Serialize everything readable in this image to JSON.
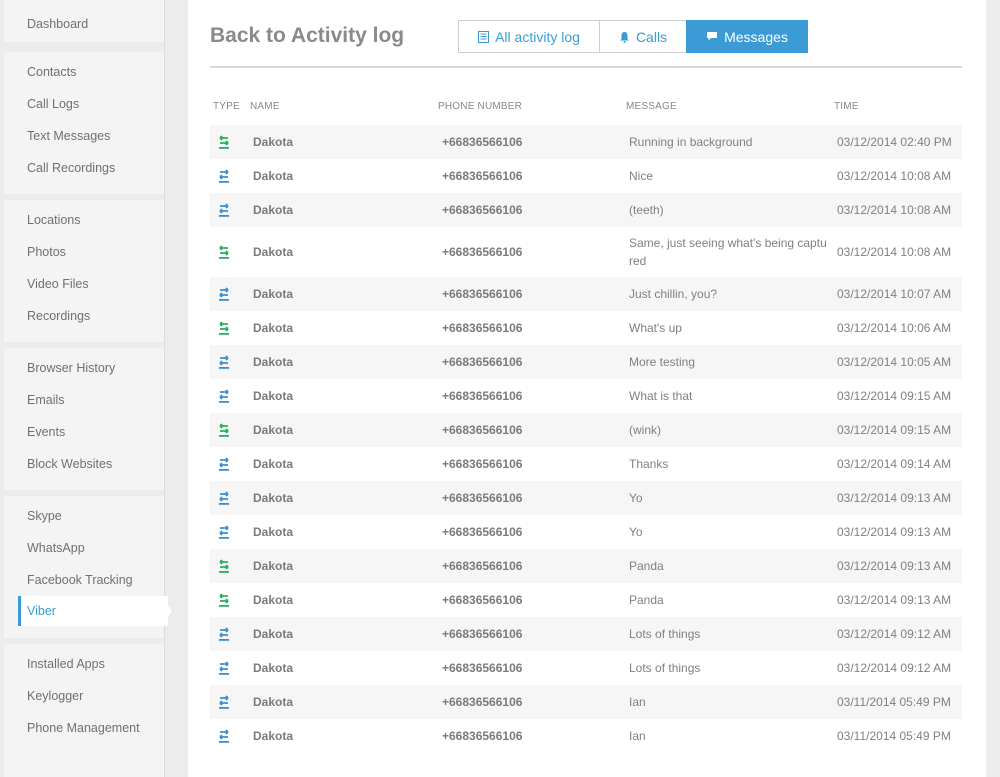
{
  "sidebar": {
    "groups": [
      {
        "items": [
          "Dashboard"
        ]
      },
      {
        "items": [
          "Contacts",
          "Call Logs",
          "Text Messages",
          "Call Recordings"
        ]
      },
      {
        "items": [
          "Locations",
          "Photos",
          "Video Files",
          "Recordings"
        ]
      },
      {
        "items": [
          "Browser History",
          "Emails",
          "Events",
          "Block Websites"
        ]
      },
      {
        "items": [
          "Skype",
          "WhatsApp",
          "Facebook Tracking",
          "Viber"
        ]
      },
      {
        "items": [
          "Installed Apps",
          "Keylogger",
          "Phone Management"
        ]
      }
    ],
    "active": "Viber",
    "accent_color": "#3b9bd7"
  },
  "header": {
    "title": "Back to Activity log",
    "tabs": [
      {
        "label": "All activity log",
        "icon": "list-icon",
        "active": false
      },
      {
        "label": "Calls",
        "icon": "bell-icon",
        "active": false
      },
      {
        "label": "Messages",
        "icon": "chat-bubble-icon",
        "active": true
      }
    ]
  },
  "table": {
    "columns": [
      "TYPE",
      "NAME",
      "PHONE NUMBER",
      "MESSAGE",
      "TIME"
    ],
    "rows": [
      {
        "type": "incoming",
        "name": "Dakota",
        "phone": "+66836566106",
        "message": "Running in background",
        "time": "03/12/2014 02:40 PM"
      },
      {
        "type": "outgoing",
        "name": "Dakota",
        "phone": "+66836566106",
        "message": "Nice",
        "time": "03/12/2014 10:08 AM"
      },
      {
        "type": "outgoing",
        "name": "Dakota",
        "phone": "+66836566106",
        "message": "(teeth)",
        "time": "03/12/2014 10:08 AM"
      },
      {
        "type": "incoming",
        "name": "Dakota",
        "phone": "+66836566106",
        "message": "Same, just seeing what's being captured",
        "time": "03/12/2014 10:08 AM"
      },
      {
        "type": "outgoing",
        "name": "Dakota",
        "phone": "+66836566106",
        "message": "Just chillin, you?",
        "time": "03/12/2014 10:07 AM"
      },
      {
        "type": "incoming",
        "name": "Dakota",
        "phone": "+66836566106",
        "message": "What's up",
        "time": "03/12/2014 10:06 AM"
      },
      {
        "type": "outgoing",
        "name": "Dakota",
        "phone": "+66836566106",
        "message": "More testing",
        "time": "03/12/2014 10:05 AM"
      },
      {
        "type": "outgoing",
        "name": "Dakota",
        "phone": "+66836566106",
        "message": "What is that",
        "time": "03/12/2014 09:15 AM"
      },
      {
        "type": "incoming",
        "name": "Dakota",
        "phone": "+66836566106",
        "message": "(wink)",
        "time": "03/12/2014 09:15 AM"
      },
      {
        "type": "outgoing",
        "name": "Dakota",
        "phone": "+66836566106",
        "message": "Thanks",
        "time": "03/12/2014 09:14 AM"
      },
      {
        "type": "outgoing",
        "name": "Dakota",
        "phone": "+66836566106",
        "message": "Yo",
        "time": "03/12/2014 09:13 AM"
      },
      {
        "type": "outgoing",
        "name": "Dakota",
        "phone": "+66836566106",
        "message": "Yo",
        "time": "03/12/2014 09:13 AM"
      },
      {
        "type": "incoming",
        "name": "Dakota",
        "phone": "+66836566106",
        "message": "Panda",
        "time": "03/12/2014 09:13 AM"
      },
      {
        "type": "incoming",
        "name": "Dakota",
        "phone": "+66836566106",
        "message": "Panda",
        "time": "03/12/2014 09:13 AM"
      },
      {
        "type": "outgoing",
        "name": "Dakota",
        "phone": "+66836566106",
        "message": "Lots of things",
        "time": "03/12/2014 09:12 AM"
      },
      {
        "type": "outgoing",
        "name": "Dakota",
        "phone": "+66836566106",
        "message": "Lots of things",
        "time": "03/12/2014 09:12 AM"
      },
      {
        "type": "outgoing",
        "name": "Dakota",
        "phone": "+66836566106",
        "message": "Ian",
        "time": "03/11/2014 05:49 PM"
      },
      {
        "type": "outgoing",
        "name": "Dakota",
        "phone": "+66836566106",
        "message": "Ian",
        "time": "03/11/2014 05:49 PM"
      }
    ]
  },
  "colors": {
    "incoming": "#27ae60",
    "outgoing": "#3b8fd0",
    "accent": "#3b9bd7"
  }
}
